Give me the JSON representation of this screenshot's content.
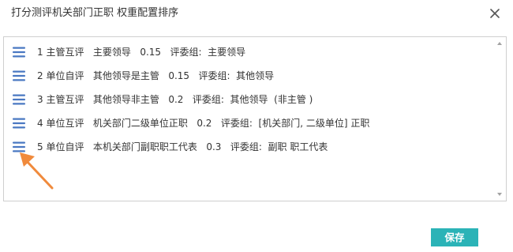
{
  "dialog": {
    "title": "打分测评机关部门正职 权重配置排序",
    "close_icon": "close-icon"
  },
  "list": {
    "drag_icon": "drag-handle-icon",
    "items": [
      {
        "text": "1 主管互评   主要领导   0.15   评委组:  主要领导"
      },
      {
        "text": "2 单位自评   其他领导是主管   0.15   评委组:  其他领导"
      },
      {
        "text": "3 主管互评   其他领导非主管   0.2   评委组:  其他领导  (非主管 )"
      },
      {
        "text": "4 单位互评   机关部门二级单位正职   0.2   评委组:  [机关部门, 二级单位] 正职"
      },
      {
        "text": "5 单位自评   本机关部门副职职工代表   0.3   评委组:  副职 职工代表"
      }
    ]
  },
  "annotation": {
    "icon": "arrow-annotation-icon",
    "color": "#f08a3c"
  },
  "footer": {
    "save_label": "保存"
  },
  "colors": {
    "accent": "#2bb3b7",
    "drag_icon": "#4a78c2",
    "annotation_arrow": "#f08a3c"
  }
}
